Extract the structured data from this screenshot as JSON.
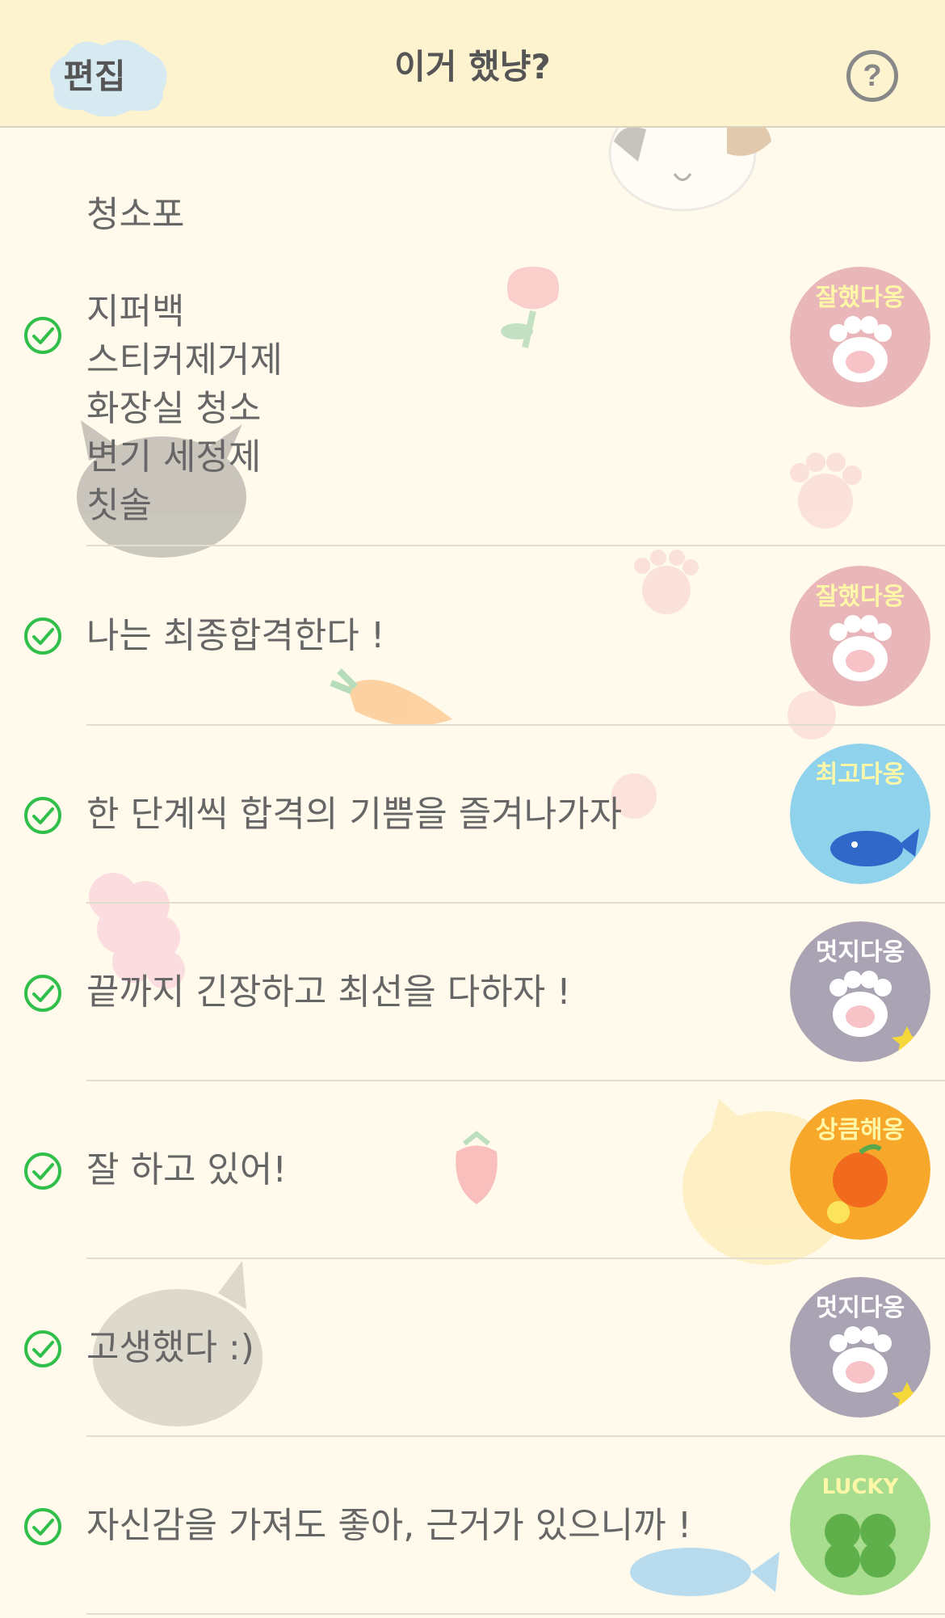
{
  "header": {
    "edit_label": "편집",
    "title": "이거 했냥?",
    "help_symbol": "?"
  },
  "section_title": "청소포",
  "items": [
    {
      "text": "지퍼백\n스티커제거제\n화장실 청소\n변기 세정제\n칫솔",
      "checked": true,
      "sticker": {
        "label": "잘했다옹",
        "theme": "pink"
      }
    },
    {
      "text": "나는 최종합격한다 !",
      "checked": true,
      "sticker": {
        "label": "잘했다옹",
        "theme": "pink"
      }
    },
    {
      "text": "한 단계씩 합격의 기쁨을 즐겨나가자",
      "checked": true,
      "sticker": {
        "label": "최고다옹",
        "theme": "blue"
      }
    },
    {
      "text": "끝까지 긴장하고 최선을 다하자 !",
      "checked": true,
      "sticker": {
        "label": "멋지다옹",
        "theme": "gray"
      }
    },
    {
      "text": "잘 하고 있어!",
      "checked": true,
      "sticker": {
        "label": "상큼해옹",
        "theme": "orange"
      }
    },
    {
      "text": "고생했다 :)",
      "checked": true,
      "sticker": {
        "label": "멋지다옹",
        "theme": "gray"
      }
    },
    {
      "text": "자신감을 가져도 좋아, 근거가 있으니까 !",
      "checked": true,
      "sticker": {
        "label": "LUCKY",
        "theme": "green"
      }
    }
  ],
  "colors": {
    "background": "#fffaeb",
    "header": "#fdf3cf",
    "check": "#2fbf4a",
    "edit_cloud": "#d8ebf0"
  }
}
